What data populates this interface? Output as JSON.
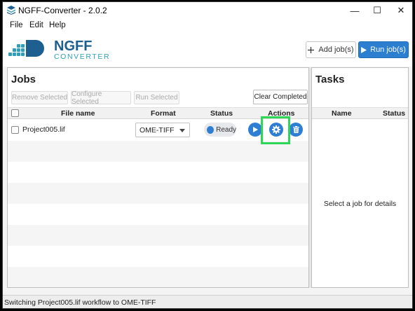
{
  "window": {
    "title": "NGFF-Converter - 2.0.2",
    "controls": {
      "minimize": "—",
      "maximize": "☐",
      "close": "✕"
    }
  },
  "menu": {
    "items": [
      "File",
      "Edit",
      "Help"
    ]
  },
  "logo": {
    "line1": "NGFF",
    "line2": "CONVERTER"
  },
  "header": {
    "add_jobs_label": "Add job(s)",
    "run_jobs_label": "Run job(s)"
  },
  "jobs": {
    "title": "Jobs",
    "toolbar": {
      "remove_selected": "Remove Selected",
      "configure_selected": "Configure Selected",
      "run_selected": "Run Selected",
      "clear_completed": "Clear Completed"
    },
    "columns": {
      "file_name": "File name",
      "format": "Format",
      "status": "Status",
      "actions": "Actions"
    },
    "rows": [
      {
        "file_name": "Project005.lif",
        "format": "OME-TIFF",
        "status": "Ready"
      }
    ]
  },
  "tasks": {
    "title": "Tasks",
    "columns": {
      "name": "Name",
      "status": "Status"
    },
    "empty_message": "Select a job for details"
  },
  "statusbar": {
    "message": "Switching Project005.lif workflow to OME-TIFF"
  },
  "colors": {
    "accent": "#2e7ed3",
    "run_button": "#2c7fd0",
    "logo_blue": "#1d5f8e",
    "logo_teal": "#2f9fb8",
    "highlight": "#2ed657"
  },
  "icons": {
    "app": "layers-icon",
    "add": "plus-icon",
    "run": "play-icon",
    "row_run": "play-icon",
    "row_settings": "gear-icon",
    "row_delete": "trash-icon"
  }
}
